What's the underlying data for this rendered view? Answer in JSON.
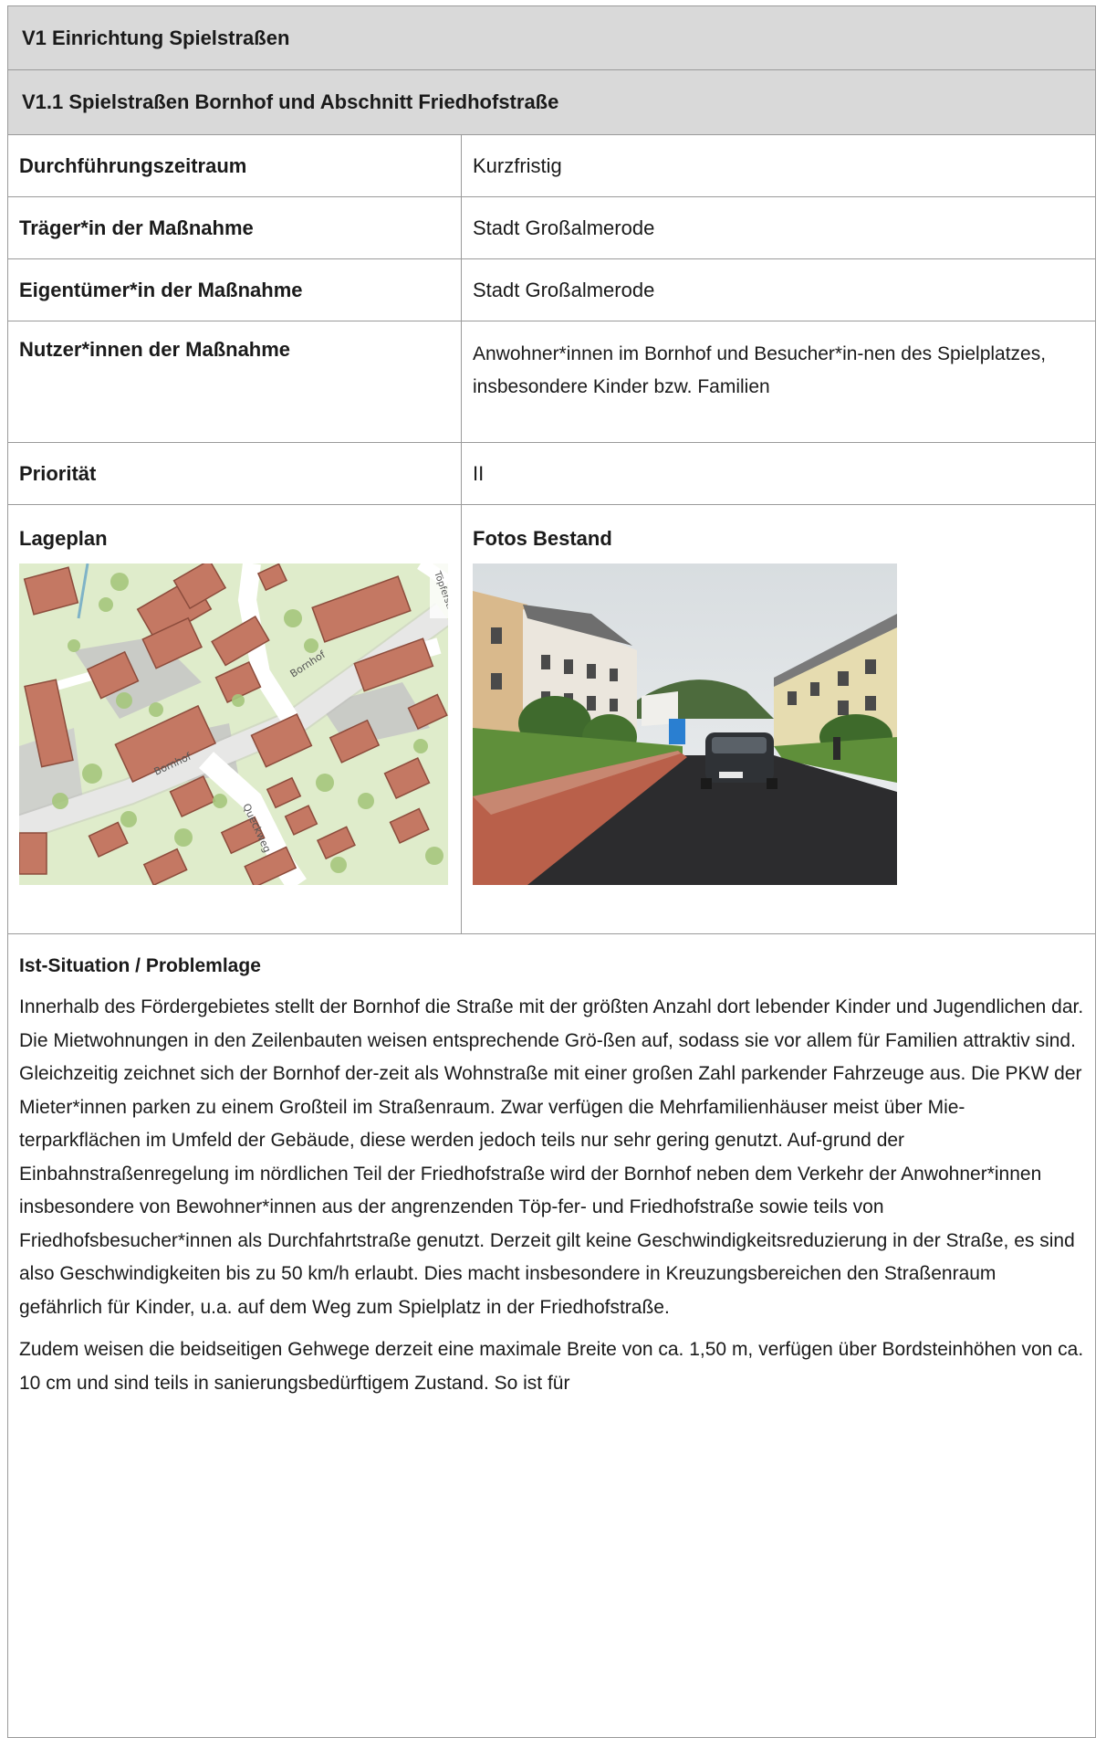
{
  "section_title": "V1 Einrichtung Spielstraßen",
  "subsection_title": "V1.1 Spielstraßen Bornhof und Abschnitt Friedhofstraße",
  "rows": [
    {
      "label": "Durchführungszeitraum",
      "value": "Kurzfristig"
    },
    {
      "label": "Träger*in der Maßnahme",
      "value": "Stadt Großalmerode"
    },
    {
      "label": "Eigentümer*in der Maßnahme",
      "value": "Stadt Großalmerode"
    },
    {
      "label": "Nutzer*innen der Maßnahme",
      "value": "Anwohner*innen im Bornhof und Besucher*in-nen des Spielplatzes, insbesondere Kinder bzw. Familien"
    },
    {
      "label": "Priorität",
      "value": "II"
    }
  ],
  "images": {
    "map_label": "Lageplan",
    "photo_label": "Fotos Bestand",
    "map_street_labels": [
      "Bornhof",
      "Bornhof",
      "Queckweg",
      "Töpferstraße"
    ]
  },
  "situation": {
    "heading": "Ist-Situation / Problemlage",
    "paragraph1": "Innerhalb des Fördergebietes stellt der Bornhof die Straße mit der größten Anzahl dort lebender Kinder und Jugendlichen dar. Die Mietwohnungen in den Zeilenbauten weisen entsprechende Grö-ßen auf, sodass sie vor allem für Familien attraktiv sind. Gleichzeitig zeichnet sich der Bornhof der-zeit als Wohnstraße mit einer großen Zahl parkender Fahrzeuge aus. Die PKW der Mieter*innen parken zu einem Großteil im Straßenraum. Zwar verfügen die Mehrfamilienhäuser meist über Mie-terparkflächen im Umfeld der Gebäude, diese werden jedoch teils nur sehr gering genutzt. Auf-grund der Einbahnstraßenregelung im nördlichen Teil der Friedhofstraße wird der Bornhof neben dem Verkehr der Anwohner*innen insbesondere von Bewohner*innen aus der angrenzenden Töp-fer- und Friedhofstraße sowie teils von Friedhofsbesucher*innen als Durchfahrtstraße genutzt. Derzeit gilt keine Geschwindigkeitsreduzierung in der Straße, es sind also Geschwindigkeiten bis zu 50 km/h erlaubt. Dies macht insbesondere in Kreuzungsbereichen den Straßenraum gefährlich für Kinder, u.a. auf dem Weg zum Spielplatz in der Friedhofstraße.",
    "paragraph2": "Zudem weisen die beidseitigen Gehwege derzeit eine maximale Breite von ca. 1,50 m, verfügen über Bordsteinhöhen von ca. 10 cm und sind teils in sanierungsbedürftigem Zustand. So ist für"
  }
}
